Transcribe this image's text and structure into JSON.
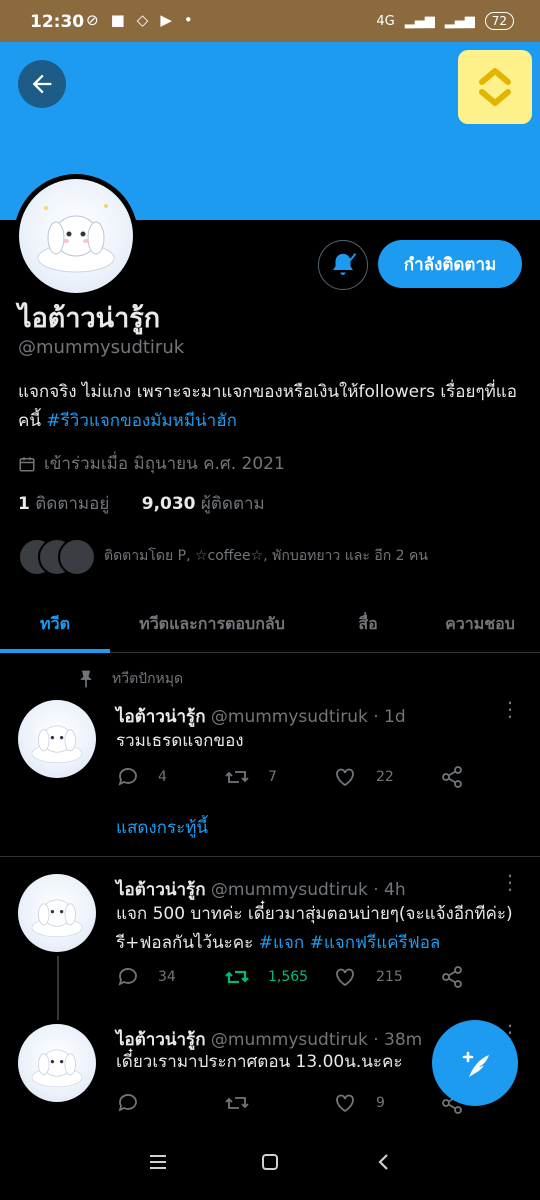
{
  "status_bar": {
    "time": "12:30",
    "network": "4G",
    "battery": "72"
  },
  "profile": {
    "display_name": "ไอต้าวน่ารู้ก",
    "handle": "@mummysudtiruk",
    "bio_text": "แจกจริง ไม่แกง  เพราะจะมาแจกของหรือเงินให้followers เรื่อยๆที่แอคนี้ ",
    "bio_hashtag": "#รีวิวแจกของมัมหมีน่าฮัก",
    "joined": "เข้าร่วมเมื่อ มิถุนายน ค.ศ. 2021",
    "following_count": "1",
    "following_label": "ติดตามอยู่",
    "followers_count": "9,030",
    "followers_label": "ผู้ติดตาม",
    "followed_by": "ติดตามโดย P, ☆coffee☆, พักบอทยาว และ อีก 2 คน",
    "follow_button": "กำลังติดตาม"
  },
  "tabs": [
    "ทวีต",
    "ทวีตและการตอบกลับ",
    "สื่อ",
    "ความชอบ"
  ],
  "pinned_label": "ทวีตปักหมุด",
  "show_thread": "แสดงกระทู้นี้",
  "tweets": [
    {
      "name": "ไอต้าวน่ารู้ก",
      "meta": "@mummysudtiruk · 1d",
      "text": "รวมเธรดแจกของ",
      "replies": "4",
      "retweets": "7",
      "likes": "22"
    },
    {
      "name": "ไอต้าวน่ารู้ก",
      "meta": "@mummysudtiruk · 4h",
      "text_line1": "แจก 500 บาทค่ะ เดี๋ยวมาสุ่มตอนบ่ายๆ(จะแจ้งอีกทีค่ะ)",
      "text_line2": "รี+ฟอลกันไว้นะคะ ",
      "tag1": "#แจก",
      "tag2": "#แจกฟรีแค่รีฟอล",
      "replies": "34",
      "retweets": "1,565",
      "likes": "215"
    },
    {
      "name": "ไอต้าวน่ารู้ก",
      "meta": "@mummysudtiruk · 38m",
      "text": "เดี๋ยวเรามาประกาศตอน 13.00น.นะคะ",
      "likes": "9"
    }
  ],
  "colors": {
    "accent": "#1d9bf0",
    "banner": "#1d9bf0",
    "retweet_active": "#00ba7c",
    "status_bar": "#8b6a3e",
    "widget": "#fef08a"
  },
  "icons": [
    "back-arrow-icon",
    "widget-chevrons-icon",
    "bell-icon",
    "calendar-icon",
    "pin-icon",
    "reply-icon",
    "retweet-icon",
    "like-icon",
    "share-icon",
    "more-icon",
    "compose-icon",
    "nav-menu-icon",
    "nav-home-icon",
    "nav-back-icon"
  ]
}
